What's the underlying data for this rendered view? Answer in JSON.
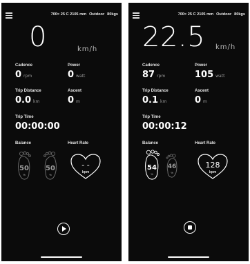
{
  "screens": [
    {
      "header": {
        "bike": "700× 25 C 2105 mm",
        "environment": "Outdoor",
        "weight": "80kgs"
      },
      "speed": {
        "value": "0",
        "unit": "km/h"
      },
      "cadence": {
        "label": "Cadence",
        "value": "0",
        "unit": "rpm"
      },
      "power": {
        "label": "Power",
        "value": "0",
        "unit": "watt"
      },
      "trip_distance": {
        "label": "Trip Distance",
        "value": "0.0",
        "unit": "km"
      },
      "ascent": {
        "label": "Ascent",
        "value": "0",
        "unit": "m"
      },
      "trip_time": {
        "label": "Trip Time",
        "value": "00:00:00"
      },
      "balance": {
        "label": "Balance",
        "left": "50",
        "right": "50",
        "unit": "%"
      },
      "heart_rate": {
        "label": "Heart Rate",
        "value": "- -",
        "unit": "bpm"
      },
      "control": {
        "icon": "play-icon"
      }
    },
    {
      "header": {
        "bike": "700× 25 C 2105 mm",
        "environment": "Outdoor",
        "weight": "80kgs"
      },
      "speed": {
        "value": "22.5",
        "unit": "km/h"
      },
      "cadence": {
        "label": "Cadence",
        "value": "87",
        "unit": "rpm"
      },
      "power": {
        "label": "Power",
        "value": "105",
        "unit": "watt"
      },
      "trip_distance": {
        "label": "Trip Distance",
        "value": "0.1",
        "unit": "km"
      },
      "ascent": {
        "label": "Ascent",
        "value": "0",
        "unit": "m"
      },
      "trip_time": {
        "label": "Trip Time",
        "value": "00:00:12"
      },
      "balance": {
        "label": "Balance",
        "left": "54",
        "right": "46",
        "unit": "%"
      },
      "heart_rate": {
        "label": "Heart Rate",
        "value": "128",
        "unit": "bpm"
      },
      "control": {
        "icon": "stop-icon"
      }
    }
  ],
  "colors": {
    "background": "#0b0b0b",
    "text": "#ffffff",
    "muted": "#9a9a9a"
  }
}
